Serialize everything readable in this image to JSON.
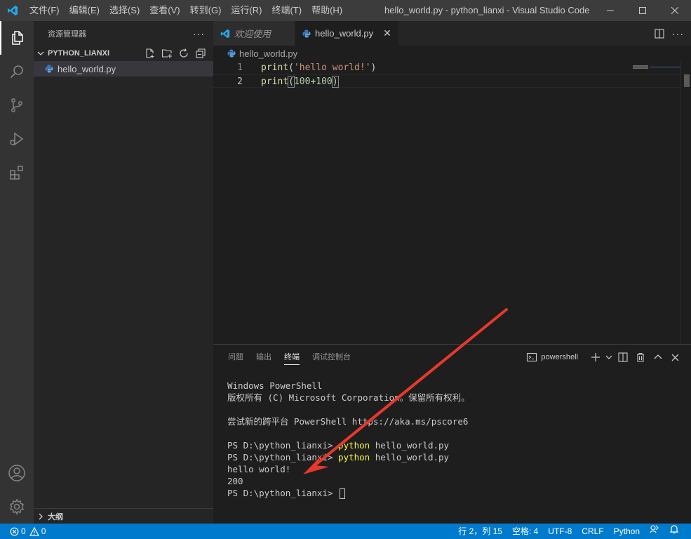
{
  "window": {
    "title": "hello_world.py - python_lianxi - Visual Studio Code",
    "menu": [
      "文件(F)",
      "编辑(E)",
      "选择(S)",
      "查看(V)",
      "转到(G)",
      "运行(R)",
      "终端(T)",
      "帮助(H)"
    ]
  },
  "activity_bar": {
    "items": [
      "explorer-icon",
      "search-icon",
      "source-control-icon",
      "run-debug-icon",
      "extensions-icon"
    ],
    "bottom": [
      "account-icon",
      "settings-gear-icon"
    ]
  },
  "sidebar": {
    "title": "资源管理器",
    "more": "···",
    "folder": "PYTHON_LIANXI",
    "files": [
      {
        "name": "hello_world.py"
      }
    ],
    "outline": "大纲"
  },
  "tabs": [
    {
      "label": "欢迎使用",
      "preview": true
    },
    {
      "label": "hello_world.py",
      "active": true,
      "close": "✕"
    }
  ],
  "breadcrumb": {
    "file": "hello_world.py"
  },
  "editor": {
    "lines": [
      {
        "no": "1",
        "tokens": [
          {
            "t": "print",
            "c": "tok-fn"
          },
          {
            "t": "(",
            "c": "tok-op"
          },
          {
            "t": "'hello world!'",
            "c": "tok-str"
          },
          {
            "t": ")",
            "c": "tok-op"
          }
        ]
      },
      {
        "no": "2",
        "tokens": [
          {
            "t": "print",
            "c": "tok-fn"
          },
          {
            "t": "(",
            "c": "tok-bracket"
          },
          {
            "t": "100",
            "c": "tok-num"
          },
          {
            "t": "+",
            "c": "tok-op"
          },
          {
            "t": "100",
            "c": "tok-num"
          },
          {
            "t": ")",
            "c": "tok-bracket"
          }
        ]
      }
    ]
  },
  "panel": {
    "tabs": [
      "问题",
      "输出",
      "终端",
      "调试控制台"
    ],
    "active_tab": "终端",
    "shell": "powershell",
    "terminal": {
      "lines": [
        {
          "text": "Windows PowerShell"
        },
        {
          "text": "版权所有 (C) Microsoft Corporation。保留所有权利。"
        },
        {
          "text": ""
        },
        {
          "text": "尝试新的跨平台 PowerShell https://aka.ms/pscore6"
        },
        {
          "text": ""
        },
        {
          "prompt": "PS D:\\python_lianxi> ",
          "cmd": "python",
          "args": " hello_world.py"
        },
        {
          "prompt": "PS D:\\python_lianxi> ",
          "cmd": "python",
          "args": " hello_world.py"
        },
        {
          "text": "hello world!"
        },
        {
          "text": "200"
        },
        {
          "prompt": "PS D:\\python_lianxi> ",
          "cursor": true
        }
      ]
    }
  },
  "statusbar": {
    "errors": "0",
    "warnings": "0",
    "position": "行 2，列 15",
    "spaces": "空格: 4",
    "encoding": "UTF-8",
    "eol": "CRLF",
    "language": "Python"
  },
  "colors": {
    "accent": "#007acc",
    "annotation_arrow": "#e8382c"
  }
}
